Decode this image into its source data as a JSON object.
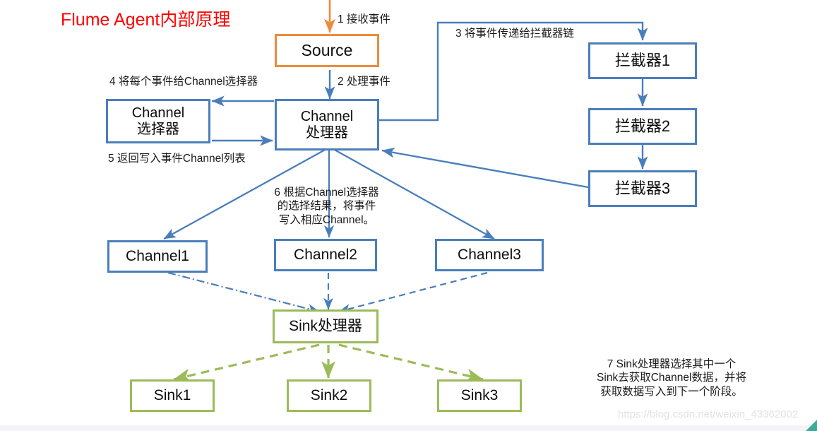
{
  "title": "Flume Agent内部原理",
  "colors": {
    "title": "#fe0000",
    "blue": "#4a7ebb",
    "orange": "#ed8b3c",
    "green": "#9bbb59",
    "text": "#0d0d0d",
    "watermark": "#e2e2e2"
  },
  "nodes": {
    "source": "Source",
    "channel_selector_line1": "Channel",
    "channel_selector_line2": "选择器",
    "channel_processor_line1": "Channel",
    "channel_processor_line2": "处理器",
    "interceptor1": "拦截器1",
    "interceptor2": "拦截器2",
    "interceptor3": "拦截器3",
    "channel1": "Channel1",
    "channel2": "Channel2",
    "channel3": "Channel3",
    "sink_processor": "Sink处理器",
    "sink1": "Sink1",
    "sink2": "Sink2",
    "sink3": "Sink3"
  },
  "annotations": {
    "step1": "1 接收事件",
    "step2": "2 处理事件",
    "step3": "3 将事件传递给拦截器链",
    "step4": "4 将每个事件给Channel选择器",
    "step5": "5 返回写入事件Channel列表",
    "step6_line1": "6 根据Channel选择器",
    "step6_line2": "的选择结果，将事件",
    "step6_line3": "写入相应Channel。",
    "step7_line1": "7 Sink处理器选择其中一个",
    "step7_line2": "Sink去获取Channel数据，并将",
    "step7_line3": "获取数据写入到下一个阶段。"
  },
  "watermark": "https://blog.csdn.net/weixin_43362002"
}
